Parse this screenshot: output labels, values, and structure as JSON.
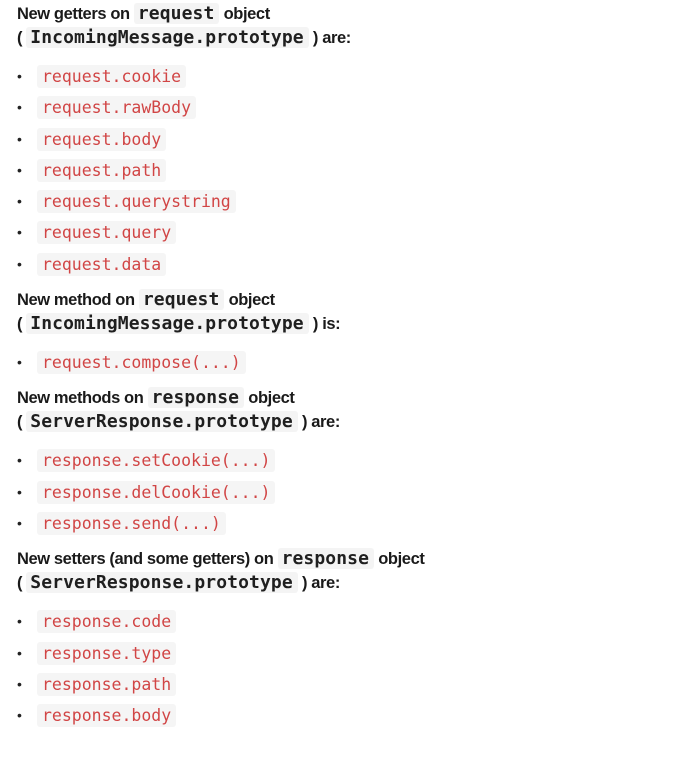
{
  "sections": [
    {
      "heading": {
        "line1_prefix": "New getters on",
        "line1_code": "request",
        "line1_suffix": "object",
        "line2_open": "(",
        "line2_code": "IncomingMessage.prototype",
        "line2_suffix": ") are:"
      },
      "items": [
        "request.cookie",
        "request.rawBody",
        "request.body",
        "request.path",
        "request.querystring",
        "request.query",
        "request.data"
      ]
    },
    {
      "heading": {
        "line1_prefix": "New method on",
        "line1_code": "request",
        "line1_suffix": "object",
        "line2_open": "(",
        "line2_code": "IncomingMessage.prototype",
        "line2_suffix": ") is:"
      },
      "items": [
        "request.compose(...)"
      ]
    },
    {
      "heading": {
        "line1_prefix": "New methods on",
        "line1_code": "response",
        "line1_suffix": "object",
        "line2_open": "(",
        "line2_code": "ServerResponse.prototype",
        "line2_suffix": ") are:"
      },
      "items": [
        "response.setCookie(...)",
        "response.delCookie(...)",
        "response.send(...)"
      ]
    },
    {
      "heading": {
        "line1_prefix": "New setters (and some getters) on",
        "line1_code": "response",
        "line1_suffix": "object",
        "line2_open": "(",
        "line2_code": "ServerResponse.prototype",
        "line2_suffix": ") are:"
      },
      "items": [
        "response.code",
        "response.type",
        "response.path",
        "response.body"
      ]
    }
  ],
  "bullet_char": "•",
  "colors": {
    "code_text": "#d14545",
    "code_bg": "#f5f5f5",
    "text": "#1a1a1a"
  }
}
